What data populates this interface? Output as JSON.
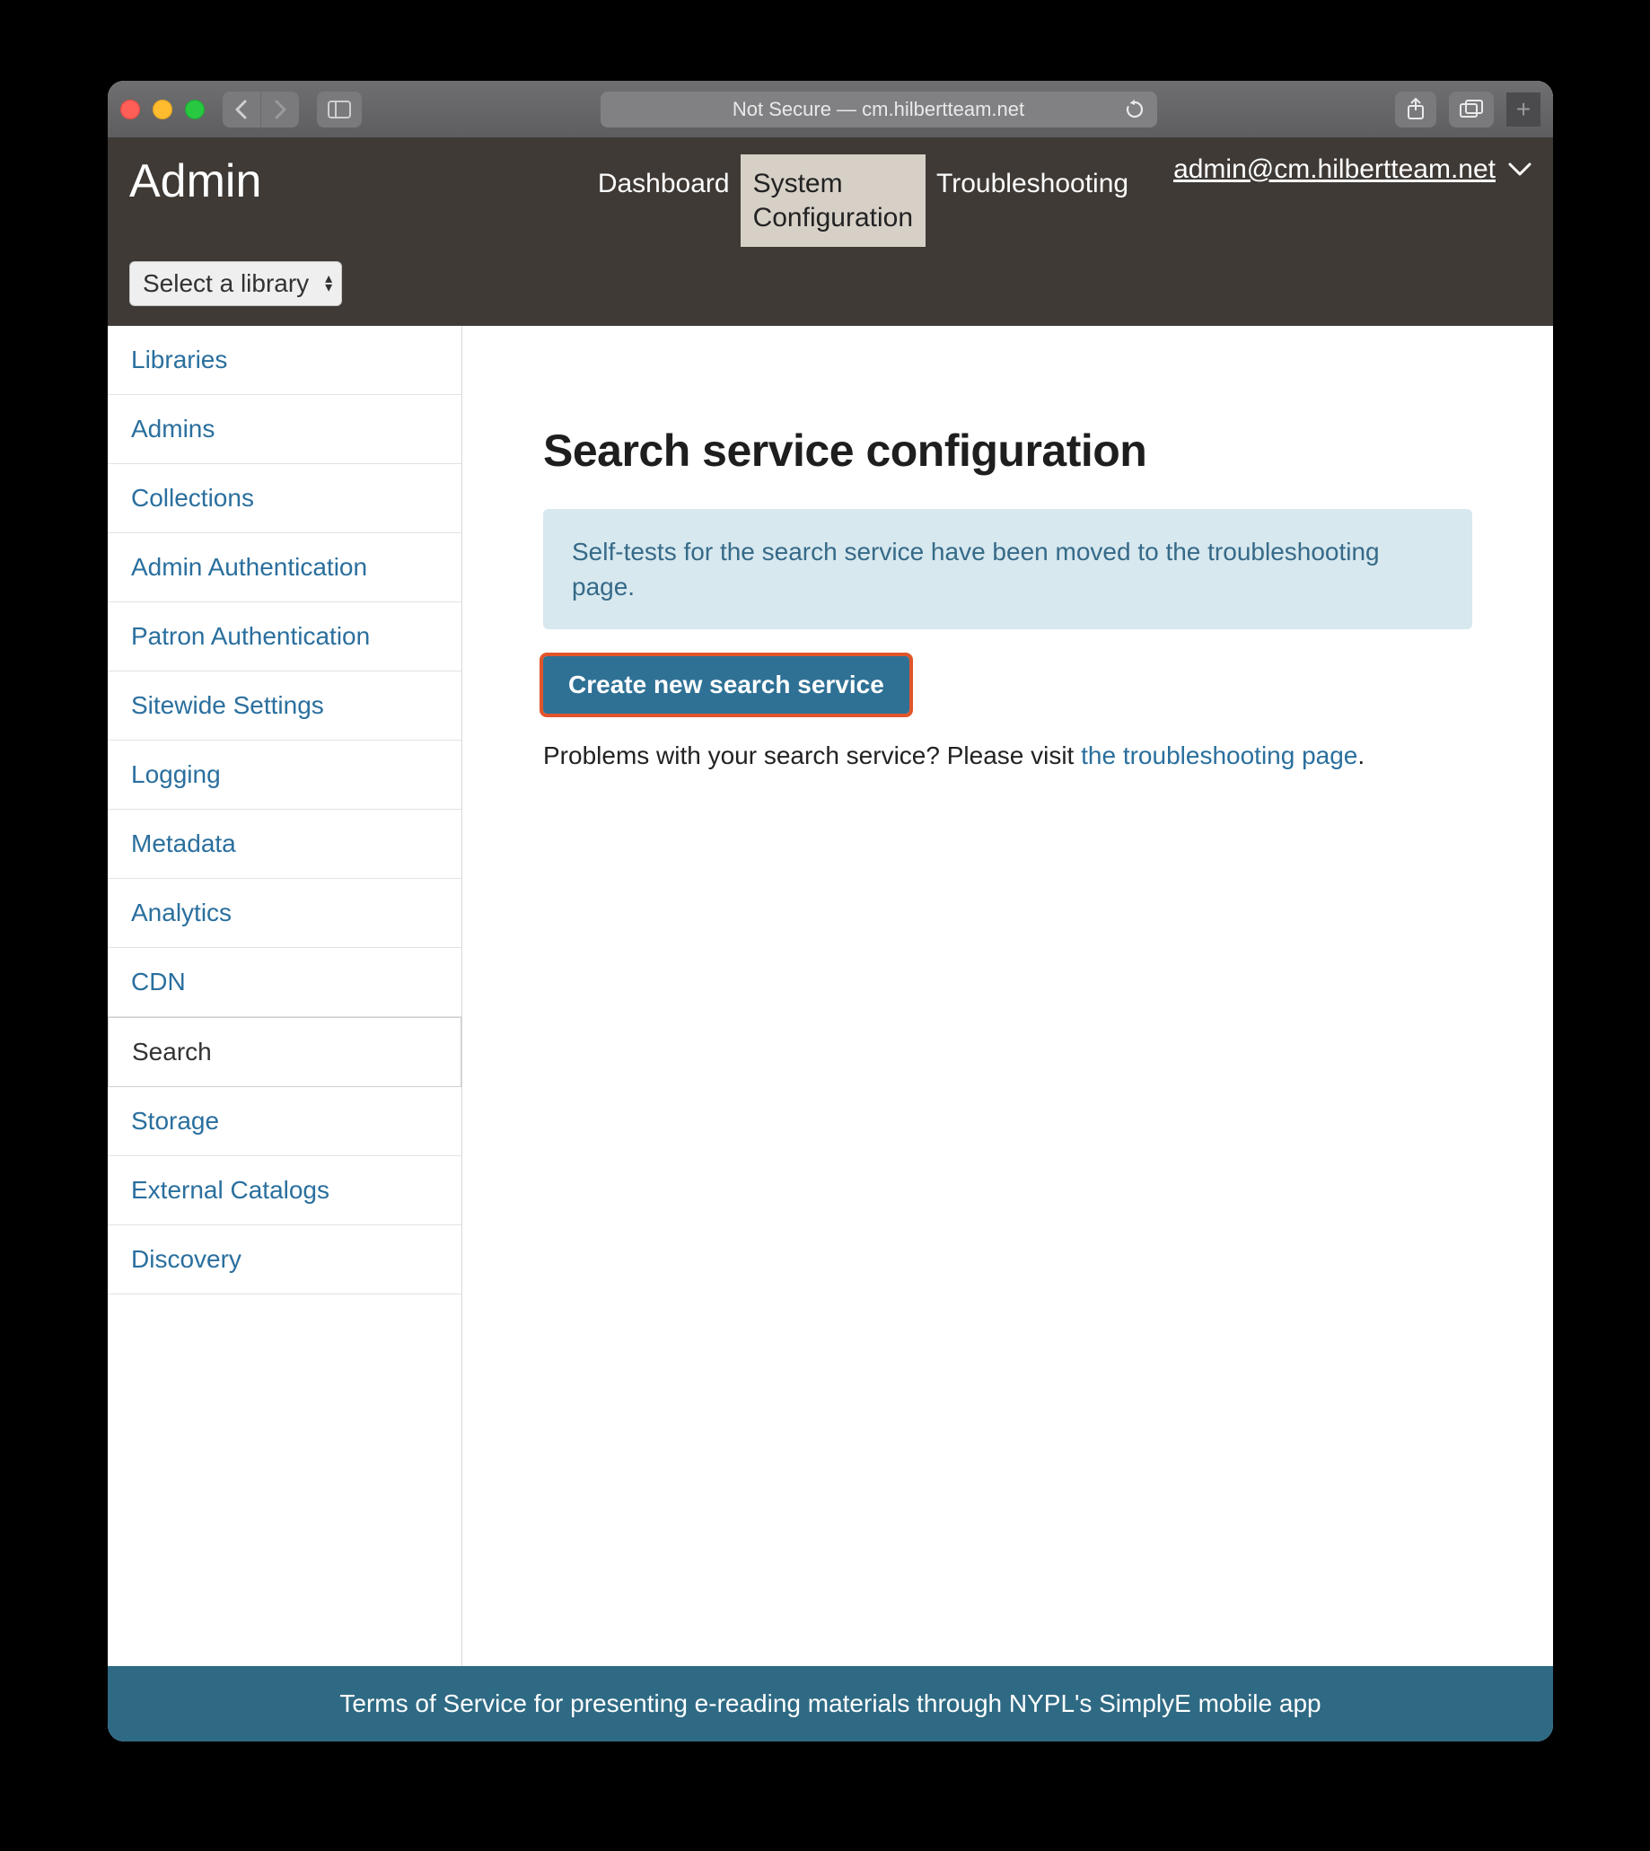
{
  "browser": {
    "address_text": "Not Secure — cm.hilbertteam.net"
  },
  "header": {
    "title": "Admin",
    "nav": {
      "dashboard": "Dashboard",
      "system_config_line1": "System",
      "system_config_line2": "Configuration",
      "troubleshooting": "Troubleshooting"
    },
    "user_email": "admin@cm.hilbertteam.net",
    "library_select_label": "Select a library"
  },
  "sidebar": {
    "items": [
      {
        "label": "Libraries"
      },
      {
        "label": "Admins"
      },
      {
        "label": "Collections"
      },
      {
        "label": "Admin Authentication"
      },
      {
        "label": "Patron Authentication"
      },
      {
        "label": "Sitewide Settings"
      },
      {
        "label": "Logging"
      },
      {
        "label": "Metadata"
      },
      {
        "label": "Analytics"
      },
      {
        "label": "CDN"
      },
      {
        "label": "Search"
      },
      {
        "label": "Storage"
      },
      {
        "label": "External Catalogs"
      },
      {
        "label": "Discovery"
      }
    ],
    "active_index": 10
  },
  "main": {
    "heading": "Search service configuration",
    "banner_text": "Self-tests for the search service have been moved to the troubleshooting page.",
    "create_button_label": "Create new search service",
    "problems_prefix": "Problems with your search service? Please visit ",
    "problems_link_text": "the troubleshooting page",
    "problems_suffix": "."
  },
  "footer": {
    "text": "Terms of Service for presenting e-reading materials through NYPL's SimplyE mobile app"
  }
}
